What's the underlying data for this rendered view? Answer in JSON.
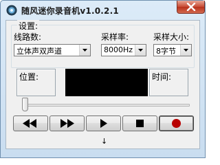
{
  "window": {
    "title": "随风迷你录音机v1.0.2.1",
    "app_icon": "record-app-icon",
    "close_icon": "close-icon"
  },
  "settings": {
    "group_label": "设置:",
    "channels": {
      "label": "线路数:",
      "value": "立体声双声道"
    },
    "sample_rate": {
      "label": "采样率:",
      "value": "8000Hz"
    },
    "sample_size": {
      "label": "采样大小:",
      "value": "8字节"
    }
  },
  "info": {
    "position_label": "位置:",
    "time_label": "时间:"
  },
  "progress": {
    "value": 0
  },
  "transport": [
    {
      "name": "rewind-button",
      "icon": "rewind-icon"
    },
    {
      "name": "fast-forward-button",
      "icon": "fast-forward-icon"
    },
    {
      "name": "play-button",
      "icon": "play-icon"
    },
    {
      "name": "stop-button",
      "icon": "stop-icon"
    },
    {
      "name": "record-button",
      "icon": "record-icon"
    }
  ],
  "status": {
    "arrow": "↓"
  },
  "colors": {
    "display_background": "#000000",
    "record_red": "#b80000",
    "close_red": "#c74a33"
  }
}
